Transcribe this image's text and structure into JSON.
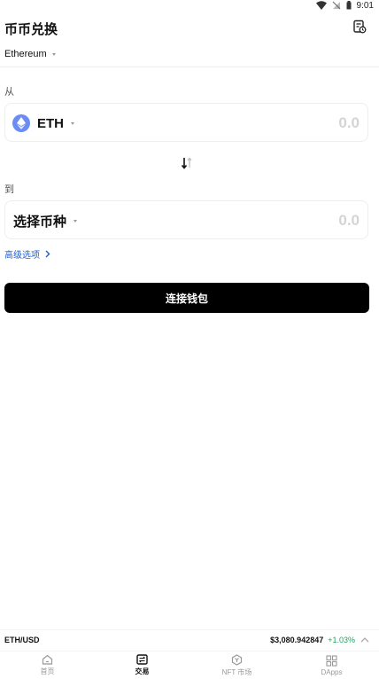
{
  "status_bar": {
    "time": "9:01"
  },
  "header": {
    "title": "币币兑换",
    "history_icon": "history-icon"
  },
  "network": {
    "name": "Ethereum"
  },
  "from_section": {
    "label": "从",
    "token": "ETH",
    "token_icon": "ethereum-icon",
    "amount_placeholder": "0.0"
  },
  "to_section": {
    "label": "到",
    "token": "选择币种",
    "amount_placeholder": "0.0"
  },
  "advanced": {
    "label": "高级选项"
  },
  "connect_button": {
    "label": "连接钱包"
  },
  "ticker": {
    "pair": "ETH/USD",
    "price": "$3,080.942847",
    "change": "+1.03%",
    "change_color": "#1aa75a"
  },
  "bottom_nav": {
    "items": [
      {
        "label": "首页",
        "icon": "home-icon"
      },
      {
        "label": "交易",
        "icon": "trade-icon",
        "active": true
      },
      {
        "label": "NFT 市场",
        "icon": "nft-market-icon"
      },
      {
        "label": "DApps",
        "icon": "dapps-grid-icon"
      }
    ]
  },
  "colors": {
    "accent": "#1f5fd1",
    "button": "#000000",
    "eth": "#6b8cf2"
  }
}
